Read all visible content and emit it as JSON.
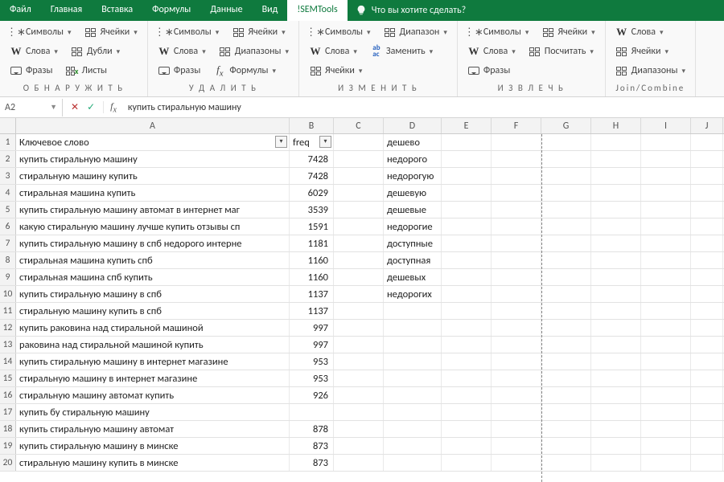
{
  "menu": {
    "tabs": [
      "Файл",
      "Главная",
      "Вставка",
      "Формулы",
      "Данные",
      "Вид",
      "!SEMTools"
    ],
    "active": 6,
    "tellme": "Что вы хотите сделать?"
  },
  "ribbon": {
    "groups": [
      {
        "label": "О Б Н А Р У Ж И Т Ь",
        "rows": [
          [
            {
              "icon": "symbols-icon",
              "text": "Символы",
              "dd": true
            },
            {
              "icon": "cells-grid-icon",
              "text": "Ячейки",
              "dd": true
            }
          ],
          [
            {
              "icon": "word-w-icon",
              "text": "Слова",
              "dd": true
            },
            {
              "icon": "dupes-grid-icon",
              "text": "Дубли",
              "dd": true
            }
          ],
          [
            {
              "icon": "phrase-bubble-icon",
              "text": "Фразы"
            },
            {
              "icon": "sheets-x-icon",
              "text": "Листы"
            }
          ]
        ]
      },
      {
        "label": "У Д А Л И Т Ь",
        "rows": [
          [
            {
              "icon": "symbols-icon",
              "text": "Символы",
              "dd": true
            },
            {
              "icon": "cells-grid-icon",
              "text": "Ячейки",
              "dd": true
            }
          ],
          [
            {
              "icon": "word-w-icon",
              "text": "Слова",
              "dd": true
            },
            {
              "icon": "ranges-grid-icon",
              "text": "Диапазоны",
              "dd": true
            }
          ],
          [
            {
              "icon": "phrase-bubble-icon",
              "text": "Фразы"
            },
            {
              "icon": "fx-icon",
              "text": "Формулы",
              "dd": true
            }
          ]
        ]
      },
      {
        "label": "И З М Е Н И Т Ь",
        "rows": [
          [
            {
              "icon": "symbols-icon",
              "text": "Символы",
              "dd": true
            },
            {
              "icon": "ranges-grid-icon",
              "text": "Диапазон",
              "dd": true
            }
          ],
          [
            {
              "icon": "word-w-icon",
              "text": "Слова",
              "dd": true
            },
            {
              "icon": "replace-abac-icon",
              "text": "Заменить",
              "dd": true
            }
          ],
          [
            {
              "icon": "cells-grid-icon",
              "text": "Ячейки",
              "dd": true
            }
          ]
        ]
      },
      {
        "label": "И З В Л Е Ч Ь",
        "rows": [
          [
            {
              "icon": "symbols-icon",
              "text": "Символы",
              "dd": true
            },
            {
              "icon": "cells-grid-icon",
              "text": "Ячейки",
              "dd": true
            }
          ],
          [
            {
              "icon": "word-w-icon",
              "text": "Слова",
              "dd": true
            },
            {
              "icon": "count-grid-icon",
              "text": "Посчитать",
              "dd": true
            }
          ],
          [
            {
              "icon": "phrase-bubble-icon",
              "text": "Фразы"
            }
          ]
        ]
      },
      {
        "label": "Join/Combine",
        "rows": [
          [
            {
              "icon": "word-w-icon",
              "text": "Слова",
              "dd": true
            }
          ],
          [
            {
              "icon": "cells-grid-icon",
              "text": "Ячейки",
              "dd": true
            }
          ],
          [
            {
              "icon": "ranges-grid-icon",
              "text": "Диапазоны",
              "dd": true
            }
          ]
        ]
      }
    ]
  },
  "formula_bar": {
    "name_box": "A2",
    "formula": "купить стиральную машину"
  },
  "grid": {
    "columns": [
      "A",
      "B",
      "C",
      "D",
      "E",
      "F",
      "G",
      "H",
      "I",
      "J"
    ],
    "header_row": {
      "A": "Ключевое слово",
      "B": "freq",
      "D": "дешево"
    },
    "rows": [
      {
        "n": 2,
        "A": "купить стиральную машину",
        "B": 7428,
        "D": "недорого"
      },
      {
        "n": 3,
        "A": "стиральную машину купить",
        "B": 7428,
        "D": "недорогую"
      },
      {
        "n": 4,
        "A": "стиральная машина купить",
        "B": 6029,
        "D": "дешевую"
      },
      {
        "n": 5,
        "A": "купить стиральную машину автомат в интернет маг",
        "B": 3539,
        "D": "дешевые"
      },
      {
        "n": 6,
        "A": "какую стиральную машину лучше купить отзывы сп",
        "B": 1591,
        "D": "недорогие"
      },
      {
        "n": 7,
        "A": "купить стиральную машину в спб недорого интерне",
        "B": 1181,
        "D": "доступные"
      },
      {
        "n": 8,
        "A": "стиральная машина купить спб",
        "B": 1160,
        "D": "доступная"
      },
      {
        "n": 9,
        "A": "стиральная машина спб купить",
        "B": 1160,
        "D": "дешевых"
      },
      {
        "n": 10,
        "A": "купить стиральную машину в спб",
        "B": 1137,
        "D": "недорогих"
      },
      {
        "n": 11,
        "A": "стиральную машину купить в спб",
        "B": 1137,
        "D": ""
      },
      {
        "n": 12,
        "A": "купить раковина над стиральной машиной",
        "B": 997,
        "D": ""
      },
      {
        "n": 13,
        "A": "раковина над стиральной машиной купить",
        "B": 997,
        "D": ""
      },
      {
        "n": 14,
        "A": "купить стиральную машину в интернет магазине",
        "B": 953,
        "D": ""
      },
      {
        "n": 15,
        "A": "стиральную машину в интернет магазине",
        "B": 953,
        "D": ""
      },
      {
        "n": 16,
        "A": "стиральную машину автомат купить",
        "B": 926,
        "D": ""
      },
      {
        "n": 17,
        "A": "купить бу стиральную машину",
        "B": "",
        "D": ""
      },
      {
        "n": 18,
        "A": "купить стиральную машину автомат",
        "B": 878,
        "D": ""
      },
      {
        "n": 19,
        "A": "купить стиральную машину в минске",
        "B": 873,
        "D": ""
      },
      {
        "n": 20,
        "A": "стиральную машину купить в минске",
        "B": 873,
        "D": ""
      }
    ]
  }
}
